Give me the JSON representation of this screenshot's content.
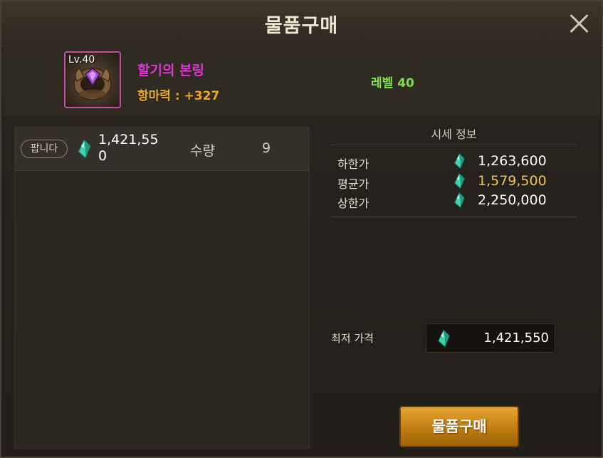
{
  "dialog": {
    "title": "물품구매",
    "close_icon": "close-icon"
  },
  "item": {
    "level_badge": "Lv.40",
    "name": "할기의 본링",
    "stat": "항마력 : +327",
    "requirement": "레벨 40",
    "name_color": "#e033d4",
    "stat_color": "#e8a82a",
    "requirement_color": "#7ee04a",
    "icon": "ring-item-icon"
  },
  "listings": [
    {
      "badge": "팝니다",
      "price": "1,421,550",
      "qty_label": "수량",
      "qty": "9",
      "currency_icon": "gem-icon"
    }
  ],
  "price_info": {
    "title": "시세 정보",
    "rows": [
      {
        "label": "하한가",
        "value": "1,263,600"
      },
      {
        "label": "평균가",
        "value": "1,579,500"
      },
      {
        "label": "상한가",
        "value": "2,250,000"
      }
    ]
  },
  "lowest": {
    "label": "최저 가격",
    "value": "1,421,550"
  },
  "buy_button": {
    "label": "물품구매",
    "color": "#c17c12"
  },
  "currency_color": "#3fd0b0"
}
